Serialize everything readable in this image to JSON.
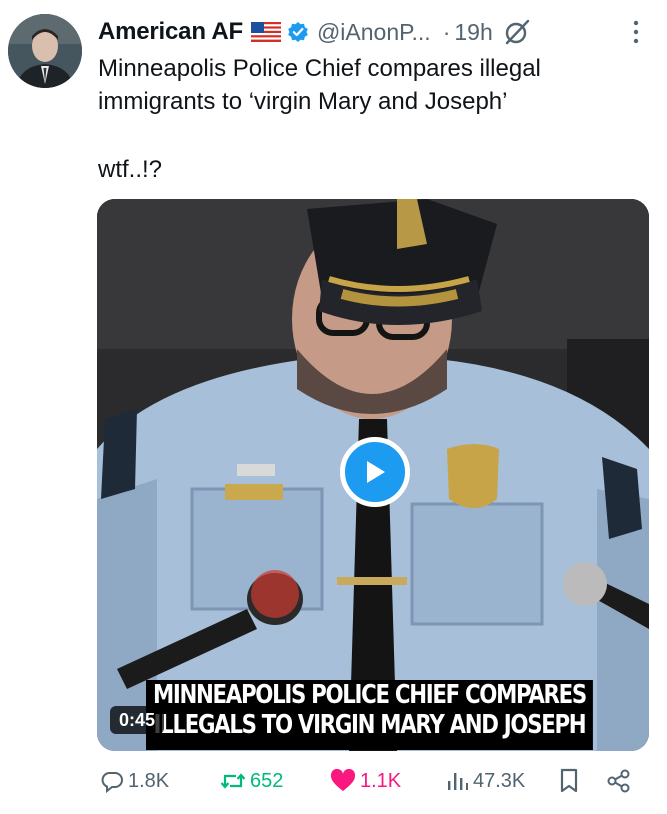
{
  "author": {
    "name": "American AF",
    "handle": "@iAnonP...",
    "separator": "·",
    "time": "19h",
    "flag_icon": "us-flag-icon",
    "verified_icon": "verified-badge-icon"
  },
  "post": {
    "text": "Minneapolis Police Chief compares illegal\nimmigrants to ‘virgin Mary and Joseph’",
    "extra": "wtf..!?"
  },
  "video": {
    "duration": "0:45",
    "caption_line1": "MINNEAPOLIS POLICE CHIEF COMPARES",
    "caption_line2": "ILLEGALS TO VIRGIN MARY AND JOSEPH",
    "play_icon": "play-icon"
  },
  "stats": {
    "replies": "1.8K",
    "reposts": "652",
    "likes": "1.1K",
    "views": "47.3K"
  },
  "colors": {
    "accent": "#1d9bf0",
    "repost": "#00ba7c",
    "like": "#f91880",
    "muted": "#536471"
  }
}
